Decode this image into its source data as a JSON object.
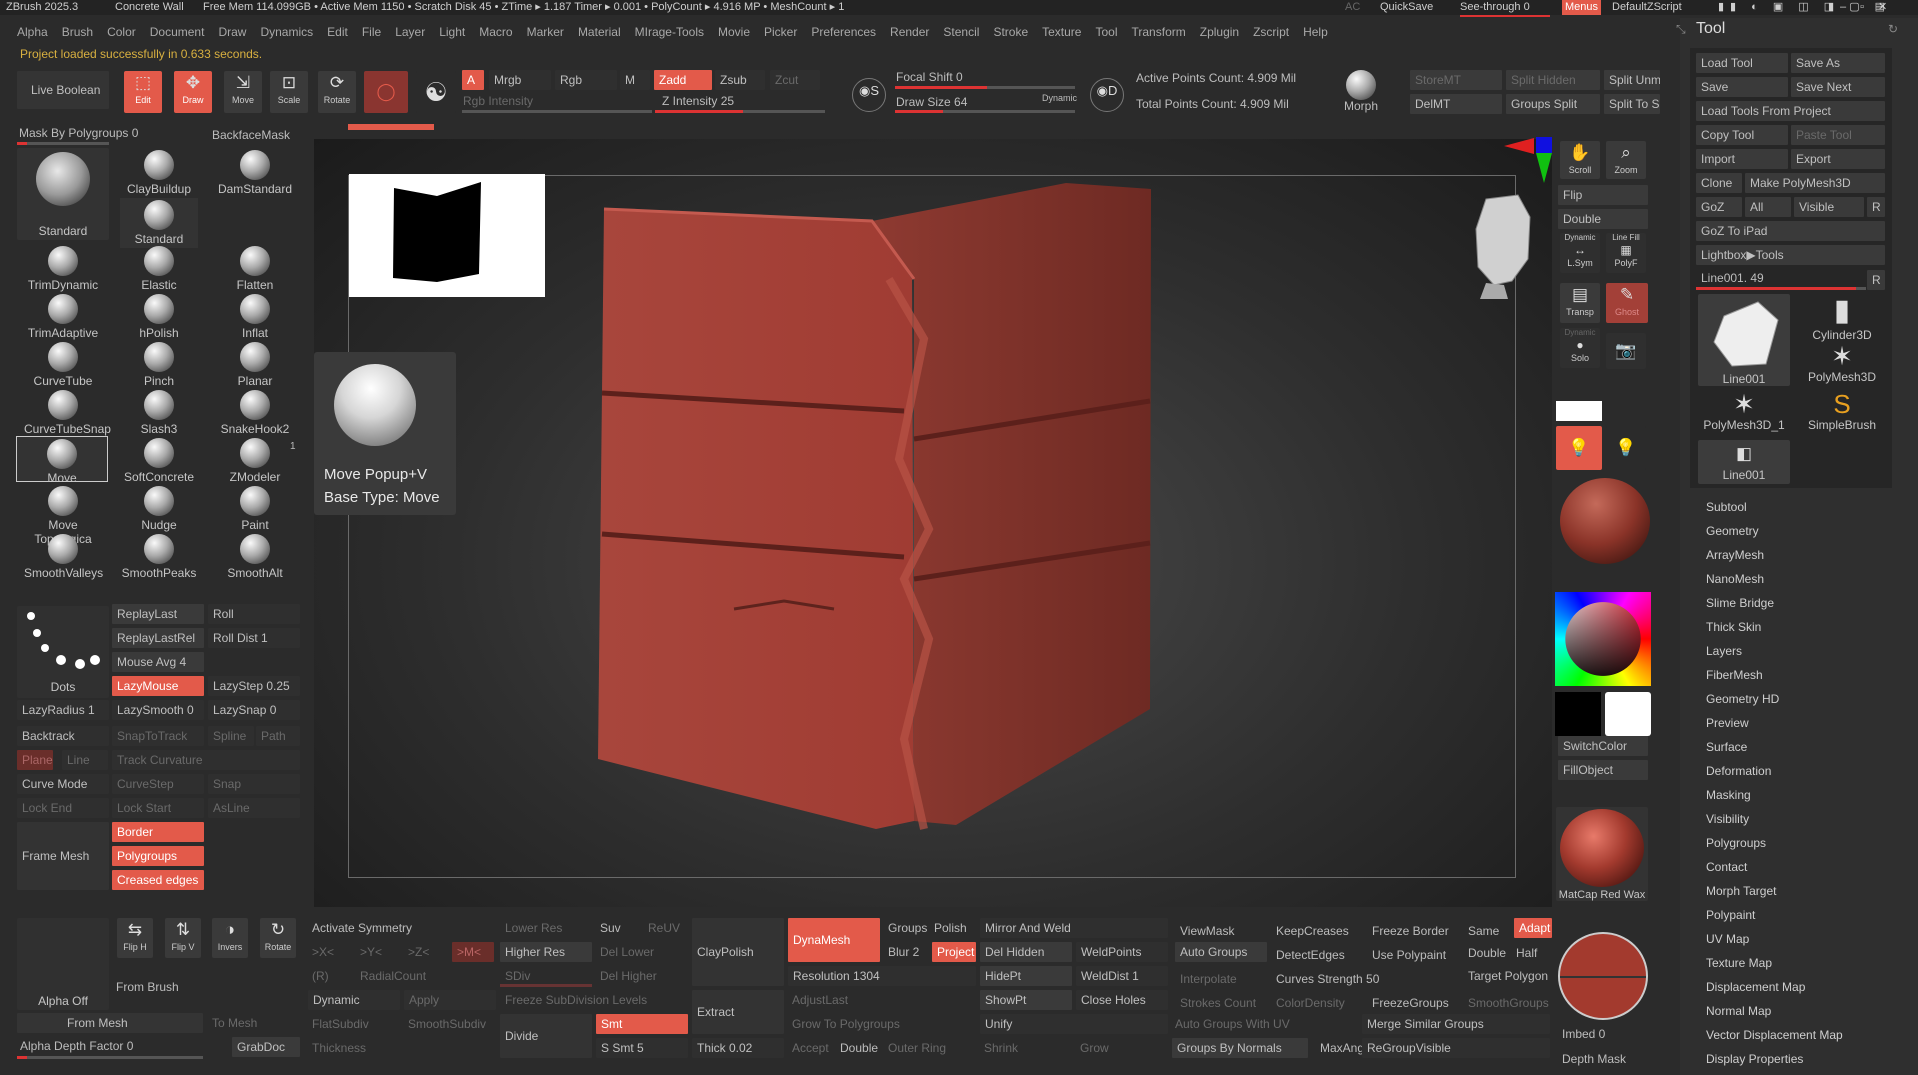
{
  "titlebar": {
    "app": "ZBrush 2025.3",
    "doc": "Concrete Wall",
    "stats": "Free Mem 114.099GB • Active Mem 1150 • Scratch Disk 45 • ZTime ▸ 1.187 Timer ▸ 0.001 • PolyCount ▸ 4.916 MP • MeshCount ▸ 1",
    "ac": "AC",
    "quicksave": "QuickSave",
    "seethrough": "See-through",
    "seethrough_val": "0",
    "menus": "Menus",
    "script": "DefaultZScript"
  },
  "menu": [
    "Alpha",
    "Brush",
    "Color",
    "Document",
    "Draw",
    "Dynamics",
    "Edit",
    "File",
    "Layer",
    "Light",
    "Macro",
    "Marker",
    "Material",
    "MIrage-Tools",
    "Movie",
    "Picker",
    "Preferences",
    "Render",
    "Stencil",
    "Stroke",
    "Texture",
    "Tool",
    "Transform",
    "Zplugin",
    "Zscript",
    "Help"
  ],
  "status": "Project loaded successfully in 0.633 seconds.",
  "toolbar": {
    "live_boolean": "Live Boolean",
    "edit": "Edit",
    "draw": "Draw",
    "move": "Move",
    "scale": "Scale",
    "rotate": "Rotate",
    "a": "A",
    "mrgb": "Mrgb",
    "rgb": "Rgb",
    "m": "M",
    "rgb_intensity": "Rgb Intensity",
    "zadd": "Zadd",
    "zsub": "Zsub",
    "zcut": "Zcut",
    "z_intensity": "Z Intensity 25",
    "focal_shift": "Focal Shift 0",
    "draw_size": "Draw Size 64",
    "dynamic": "Dynamic",
    "active_points": "Active Points Count: 4.909 Mil",
    "total_points": "Total Points Count: 4.909 Mil",
    "morph": "Morph",
    "storemt": "StoreMT",
    "delmt": "DelMT",
    "split_hidden": "Split Hidden",
    "groups_split": "Groups Split",
    "split_unm": "Split Unm",
    "split_to": "Split To S"
  },
  "left": {
    "mask_by_polygroups": "Mask By Polygroups 0",
    "backface_mask": "BackfaceMask",
    "brushes": [
      "ClayBuildup",
      "DamStandard",
      "Standard",
      "Standard",
      "TrimDynamic",
      "Elastic",
      "Flatten",
      "TrimAdaptive",
      "hPolish",
      "Inflat",
      "CurveTube",
      "Pinch",
      "Planar",
      "CurveTubeSnap",
      "Slash3",
      "SnakeHook2",
      "Move",
      "SoftConcrete",
      "ZModeler",
      "Move Topologica",
      "Nudge",
      "Paint",
      "SmoothValleys",
      "SmoothPeaks",
      "SmoothAlt"
    ],
    "zmodeler_badge": "1",
    "replay_last": "ReplayLast",
    "replay_last_rel": "ReplayLastRel",
    "roll": "Roll",
    "roll_dist": "Roll Dist 1",
    "mouse_avg": "Mouse Avg 4",
    "lazymouse": "LazyMouse",
    "lazystep": "LazyStep 0.25",
    "dots": "Dots",
    "lazyradius": "LazyRadius 1",
    "lazysmooth": "LazySmooth 0",
    "lazysnap": "LazySnap 0",
    "backtrack": "Backtrack",
    "snaptotrack": "SnapToTrack",
    "spline": "Spline",
    "path": "Path",
    "plane": "Plane",
    "line": "Line",
    "track_curvature": "Track Curvature",
    "curve_mode": "Curve Mode",
    "curvestep": "CurveStep",
    "snap": "Snap",
    "lock_end": "Lock End",
    "lock_start": "Lock Start",
    "asline": "AsLine",
    "frame_mesh": "Frame Mesh",
    "border": "Border",
    "polygroups": "Polygroups",
    "creased_edges": "Creased edges",
    "alpha_off": "Alpha Off",
    "flip_h": "Flip H",
    "flip_v": "Flip V",
    "invers": "Invers",
    "rotate": "Rotate",
    "from_brush": "From Brush",
    "from_mesh": "From Mesh",
    "to_mesh": "To Mesh",
    "alpha_depth": "Alpha Depth Factor 0",
    "grabdoc": "GrabDoc"
  },
  "popup": {
    "line1": "Move  Popup+V",
    "line2": "Base Type: Move"
  },
  "bottom": {
    "activate_symmetry": "Activate Symmetry",
    "x": ">X<",
    "y": ">Y<",
    "z": ">Z<",
    "m": ">M<",
    "r": "(R)",
    "radial_count": "RadialCount",
    "dynamic": "Dynamic",
    "apply": "Apply",
    "flatsubdiv": "FlatSubdiv",
    "smoothsubdiv": "SmoothSubdiv",
    "thickness": "Thickness",
    "lower_res": "Lower Res",
    "higher_res": "Higher Res",
    "sdiv": "SDiv",
    "freeze_subdiv": "Freeze SubDivision Levels",
    "divide": "Divide",
    "suv": "Suv",
    "reuv": "ReUV",
    "del_lower": "Del Lower",
    "del_higher": "Del Higher",
    "smt": "Smt",
    "s_smt": "S Smt 5",
    "claypolish": "ClayPolish",
    "extract": "Extract",
    "thick": "Thick 0.02",
    "dynamesh": "DynaMesh",
    "groups": "Groups",
    "polish": "Polish",
    "blur": "Blur 2",
    "project": "Project",
    "resolution": "Resolution 1304",
    "adjustlast": "AdjustLast",
    "grow_to_polygroups": "Grow To Polygroups",
    "accept": "Accept",
    "double": "Double",
    "outer_ring": "Outer Ring",
    "mirror_and_weld": "Mirror And Weld",
    "del_hidden": "Del Hidden",
    "weldpoints": "WeldPoints",
    "hidept": "HidePt",
    "welddist": "WeldDist 1",
    "showpt": "ShowPt",
    "close_holes": "Close Holes",
    "unify": "Unify",
    "shrink": "Shrink",
    "grow": "Grow",
    "viewmask": "ViewMask",
    "auto_groups": "Auto Groups",
    "interpolate": "Interpolate",
    "strokes_count": "Strokes Count",
    "auto_groups_uv": "Auto Groups With UV",
    "groups_by_normals": "Groups By Normals",
    "keepcreases": "KeepCreases",
    "detectedges": "DetectEdges",
    "curves_strength": "Curves Strength 50",
    "colordensity": "ColorDensity",
    "maxang": "MaxAng",
    "freeze_border": "Freeze Border",
    "use_polypaint": "Use Polypaint",
    "freezegroups": "FreezeGroups",
    "merge_similar": "Merge Similar Groups",
    "regroupvisible": "ReGroupVisible",
    "same": "Same",
    "adapt": "Adapt",
    "double2": "Double",
    "half": "Half",
    "target_polygon": "Target Polygon",
    "smoothgroups": "SmoothGroups"
  },
  "rightshelf": {
    "scroll": "Scroll",
    "zoom": "Zoom",
    "flip": "Flip",
    "double": "Double",
    "dynamic": "Dynamic",
    "line_fill": "Line Fill",
    "lsym": "L.Sym",
    "polyf": "PolyF",
    "transp": "Transp",
    "ghost": "Ghost",
    "dynamic2": "Dynamic",
    "solo": "Solo",
    "switchcolor": "SwitchColor",
    "fillobject": "FillObject",
    "matcap": "MatCap Red Wax",
    "imbed": "Imbed 0",
    "depth_mask": "Depth Mask"
  },
  "tool": {
    "title": "Tool",
    "load_tool": "Load Tool",
    "save_as": "Save As",
    "save": "Save",
    "save_next": "Save Next",
    "load_from_project": "Load Tools From Project",
    "copy_tool": "Copy Tool",
    "paste_tool": "Paste Tool",
    "import": "Import",
    "export": "Export",
    "clone": "Clone",
    "make_polymesh": "Make PolyMesh3D",
    "goz": "GoZ",
    "all": "All",
    "visible": "Visible",
    "r": "R",
    "goz_ipad": "GoZ To iPad",
    "lightbox": "Lightbox▶Tools",
    "current": "Line001. 49",
    "thumbs": [
      "Line001",
      "Cylinder3D",
      "PolyMesh3D",
      "PolyMesh3D_1",
      "SimpleBrush",
      "Line001"
    ],
    "menu": [
      "Subtool",
      "Geometry",
      "ArrayMesh",
      "NanoMesh",
      "Slime Bridge",
      "Thick Skin",
      "Layers",
      "FiberMesh",
      "Geometry HD",
      "Preview",
      "Surface",
      "Deformation",
      "Masking",
      "Visibility",
      "Polygroups",
      "Contact",
      "Morph Target",
      "Polypaint",
      "UV Map",
      "Texture Map",
      "Displacement Map",
      "Normal Map",
      "Vector Displacement Map",
      "Display Properties"
    ]
  },
  "colors": {
    "accent": "#e35a4a",
    "clay": "#a8423a",
    "bg": "#2b2b2b"
  }
}
